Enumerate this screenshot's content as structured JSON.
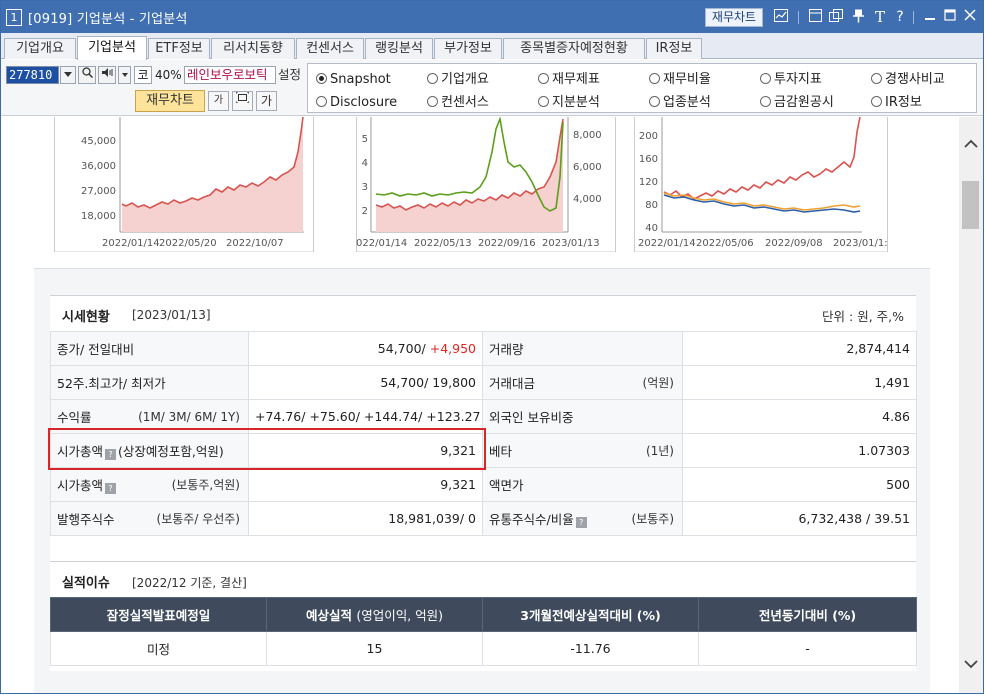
{
  "window": {
    "number": "1",
    "title": "[0919] 기업분석 - 기업분석",
    "chart_button": "재무차트",
    "icons": [
      "chart-icon",
      "restore-icon",
      "copy-icon",
      "pin-icon",
      "font-icon",
      "help-icon",
      "minimize-icon",
      "maximize-icon",
      "close-icon"
    ],
    "icon_glyphs": {
      "font": "T",
      "help": "?"
    }
  },
  "tabs": [
    "기업개요",
    "기업분석",
    "ETF정보",
    "리서치동향",
    "컨센서스",
    "랭킹분석",
    "부가정보",
    "종목별증자예정현황",
    "IR정보"
  ],
  "active_tab": "기업분석",
  "toolbar": {
    "code": "277810",
    "market_badge": "코",
    "pct": "40%",
    "stock_name": "레인보우로보틱",
    "settings_label": "설정",
    "chart_button": "재무차트",
    "opt1": "가",
    "opt3": "가"
  },
  "radios": [
    {
      "label": "Snapshot",
      "checked": true
    },
    {
      "label": "기업개요",
      "checked": false
    },
    {
      "label": "재무제표",
      "checked": false
    },
    {
      "label": "재무비율",
      "checked": false
    },
    {
      "label": "투자지표",
      "checked": false
    },
    {
      "label": "경쟁사비교",
      "checked": false
    },
    {
      "label": "Disclosure",
      "checked": false
    },
    {
      "label": "컨센서스",
      "checked": false
    },
    {
      "label": "지분분석",
      "checked": false
    },
    {
      "label": "업종분석",
      "checked": false
    },
    {
      "label": "금감원공시",
      "checked": false
    },
    {
      "label": "IR정보",
      "checked": false
    }
  ],
  "charts": [
    {
      "y_ticks": [
        "45,000",
        "36,000",
        "27,000",
        "18,000"
      ],
      "x_ticks": [
        "2022/01/14",
        "2022/05/20",
        "2022/10/07"
      ],
      "color": "#d9534f"
    },
    {
      "y_ticks_left": [
        "5",
        "4",
        "3",
        "2"
      ],
      "y_ticks_right": [
        "8,000",
        "6,000",
        "4,000"
      ],
      "x_ticks": [
        "022/01/14",
        "2022/05/13",
        "2022/09/16",
        "2023/01/13"
      ],
      "colors": [
        "#d9534f",
        "#5a9e1a"
      ]
    },
    {
      "y_ticks": [
        "200",
        "160",
        "120",
        "80",
        "40"
      ],
      "x_ticks": [
        "2022/01/14",
        "2022/05/06",
        "2022/09/08",
        "2023/01/1:"
      ],
      "colors": [
        "#d9534f",
        "#f0a030",
        "#2c5fa8"
      ]
    }
  ],
  "quote": {
    "title": "시세현황",
    "date": "[2023/01/13]",
    "unit": "단위 : 원, 주,%",
    "rows": [
      {
        "l1": "종가/ 전일대비",
        "l1sub": "",
        "v1": "54,700/ ",
        "v1red": "+4,950",
        "l2": "거래량",
        "l2sub": "",
        "v2": "2,874,414"
      },
      {
        "l1": "52주.최고가/ 최저가",
        "l1sub": "",
        "v1": "54,700/ 19,800",
        "v1red": "",
        "l2": "거래대금",
        "l2sub": "(억원)",
        "v2": "1,491"
      },
      {
        "l1": "수익률",
        "l1sub": "(1M/ 3M/ 6M/ 1Y)",
        "v1": "",
        "v1red": "+74.76/ +75.60/ +144.74/ +123.27",
        "l2": "외국인 보유비중",
        "l2sub": "",
        "v2": "4.86"
      },
      {
        "l1": "시가총액",
        "l1sub": "(상장예정포함,억원)",
        "v1": "9,321",
        "v1red": "",
        "l2": "베타",
        "l2sub": "(1년)",
        "v2": "1.07303"
      },
      {
        "l1": "시가총액",
        "l1sub": "(보통주,억원)",
        "v1": "9,321",
        "v1red": "",
        "l2": "액면가",
        "l2sub": "",
        "v2": "500"
      },
      {
        "l1": "발행주식수",
        "l1sub": "(보통주/ 우선주)",
        "v1": "18,981,039/ 0",
        "v1red": "",
        "l2": "유통주식수/비율",
        "l2sub": "(보통주)",
        "v2": "6,732,438 / 39.51"
      }
    ],
    "help_icon": "?"
  },
  "earnings": {
    "title": "실적이슈",
    "date": "[2022/12 기준, 결산]",
    "headers": [
      {
        "bold": "잠정실적발표예정일",
        "thin": ""
      },
      {
        "bold": "예상실적",
        "thin": "(영업이익, 억원)"
      },
      {
        "bold": "3개월전예상실적대비 (%)",
        "thin": ""
      },
      {
        "bold": "전년동기대비 (%)",
        "thin": ""
      }
    ],
    "row": [
      "미정",
      "15",
      "-11.76",
      "-"
    ]
  },
  "accent_color": "#3f6fb0",
  "highlight_color": "#d7262b"
}
